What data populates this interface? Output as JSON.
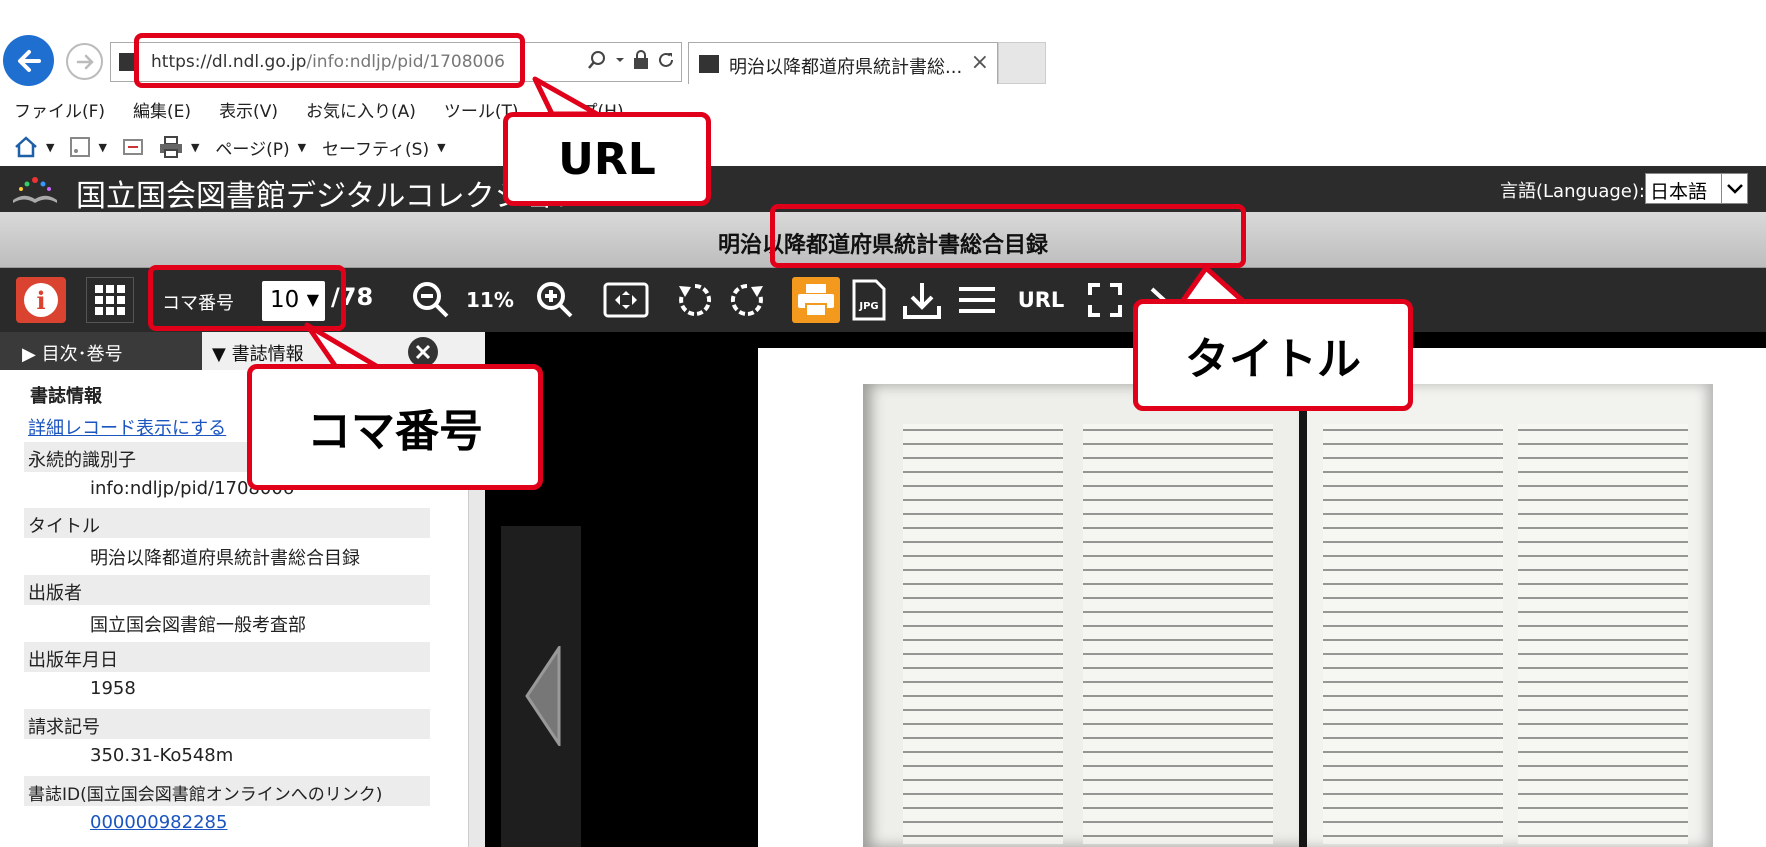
{
  "browser": {
    "url_prefix": "https://dl.ndl.go.jp",
    "url_rest": "/info:ndljp/pid/1708006",
    "tab_title": "明治以降都道府県統計書総...",
    "tab_close": "×"
  },
  "menubar": [
    "ファイル(F)",
    "編集(E)",
    "表示(V)",
    "お気に入り(A)",
    "ツール(T)",
    "ヘルプ(H)"
  ],
  "commandbar": {
    "page": "ページ(P)",
    "safety": "セーフティ(S)"
  },
  "site": {
    "title": "国立国会図書館デジタルコレクション",
    "language_label": "言語(Language):",
    "language_value": "日本語"
  },
  "book": {
    "title": "明治以降都道府県統計書総合目録"
  },
  "toolbar": {
    "koma_label": "コマ番号",
    "koma_value": "10",
    "koma_total": "/78",
    "zoom": "11%",
    "url_label": "URL"
  },
  "panel": {
    "tab_toc": "▶ 目次･巻号",
    "tab_biblio": "▼ 書誌情報",
    "heading": "書誌情報",
    "detail_link": "詳細レコード表示にする",
    "fields": [
      {
        "label": "永続的識別子",
        "value": "info:ndljp/pid/1708006"
      },
      {
        "label": "タイトル",
        "value": "明治以降都道府県統計書総合目録"
      },
      {
        "label": "出版者",
        "value": "国立国会図書館一般考査部"
      },
      {
        "label": "出版年月日",
        "value": "1958"
      },
      {
        "label": "請求記号",
        "value": "350.31-Ko548m"
      },
      {
        "label": "書誌ID(国立国会図書館オンラインへのリンク)",
        "value": "000000982285"
      }
    ]
  },
  "annotations": {
    "url": "URL",
    "title": "タイトル",
    "koma": "コマ番号"
  },
  "colors": {
    "highlight": "#e0001a",
    "print_button": "#f39a1e",
    "info_button": "#d9432f",
    "back_button": "#1f6fd1"
  },
  "icons": [
    "back-arrow-icon",
    "forward-arrow-icon",
    "search-icon",
    "lock-icon",
    "refresh-icon",
    "home-icon",
    "rss-icon",
    "mail-icon",
    "printer-icon",
    "info-icon",
    "thumbnail-grid-icon",
    "zoom-out-icon",
    "zoom-in-icon",
    "fit-icon",
    "rotate-left-icon",
    "rotate-right-icon",
    "jpg-icon",
    "download-icon",
    "list-icon",
    "fullscreen-icon",
    "close-icon",
    "prev-page-icon"
  ]
}
